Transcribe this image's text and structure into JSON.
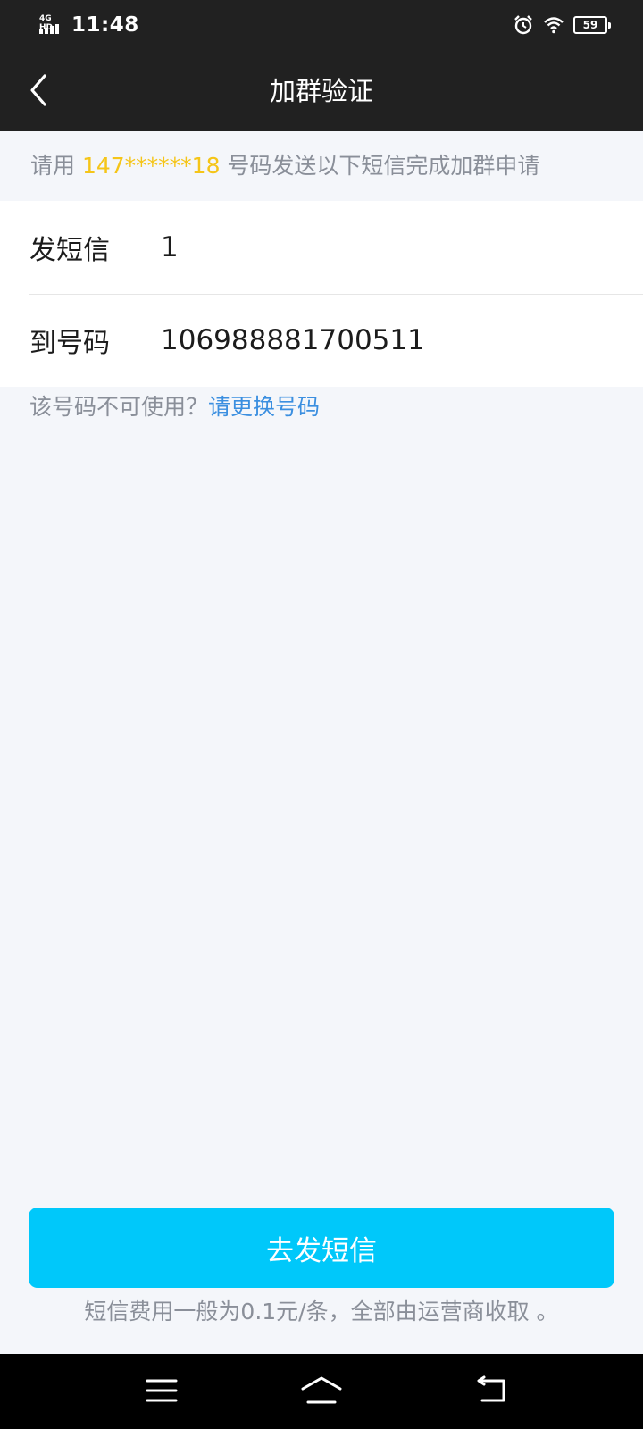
{
  "status_bar": {
    "network": "4G HD",
    "time": "11:48",
    "battery": "59"
  },
  "nav": {
    "title": "加群验证"
  },
  "hint": {
    "prefix": "请用 ",
    "phone": "147******18",
    "suffix": " 号码发送以下短信完成加群申请"
  },
  "sms": {
    "content_label": "发短信",
    "content_value": "1",
    "number_label": "到号码",
    "number_value": "106988881700511"
  },
  "unavailable": {
    "question": "该号码不可使用？",
    "link": "请更换号码"
  },
  "send_button": {
    "label": "去发短信"
  },
  "fee_note": "短信费用一般为0.1元/条，全部由运营商收取 。",
  "colors": {
    "header_bg": "#212121",
    "page_bg": "#f4f6fa",
    "phone_highlight": "#f5c518",
    "link": "#3b8fe0",
    "button": "#00c8fa"
  }
}
